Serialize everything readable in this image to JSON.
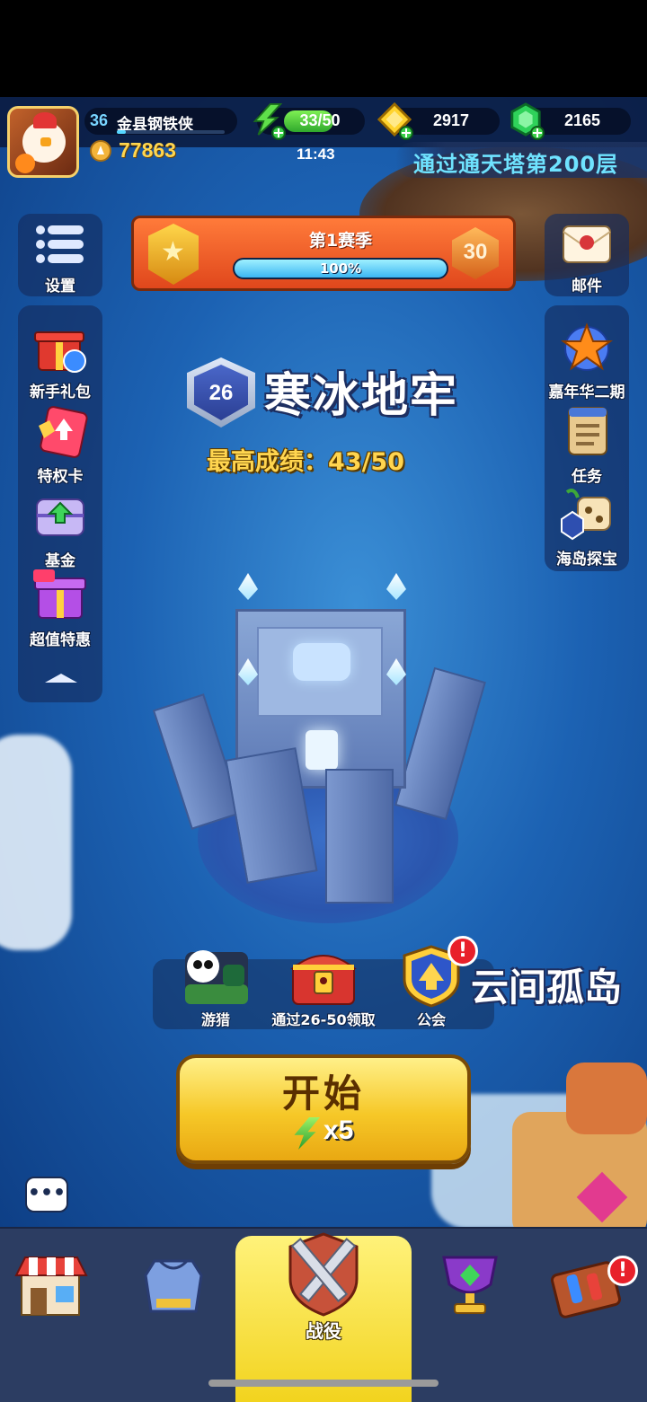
{
  "player": {
    "level": "36",
    "name": "金县钢铁侠",
    "xp_fraction": 0.08,
    "trophies": "77863"
  },
  "resources": {
    "energy": "33/50",
    "energy_fraction": 0.66,
    "gold": "2917",
    "gems": "2165",
    "energy_timer": "11:43"
  },
  "quest_banner": "通过通天塔第200层",
  "left_menu": {
    "settings": "设置",
    "items": [
      "新手礼包",
      "特权卡",
      "基金",
      "超值特惠"
    ]
  },
  "right_menu": {
    "mail": "邮件",
    "items": [
      "嘉年华二期",
      "任务",
      "海岛探宝"
    ]
  },
  "season": {
    "title": "第1赛季",
    "progress": "100%",
    "progress_fraction": 1.0,
    "level": "30"
  },
  "stage": {
    "number": "26",
    "name": "寒冰地牢",
    "best_score": "最高成绩：43/50"
  },
  "quick_actions": {
    "hunt": "游猎",
    "chest": "通过26-50领取",
    "guild": "公会",
    "guild_alert": "!"
  },
  "next_island": "云间孤岛",
  "start_button": {
    "label": "开始",
    "cost": "x5"
  },
  "chat": "•••",
  "bottom_nav": {
    "active_label": "战役",
    "alert": "!"
  },
  "colors": {
    "accent_yellow": "#f6c828",
    "nav_bg": "#2c3d62",
    "season_orange": "#e0471c",
    "alert_red": "#e8202a"
  },
  "icons": [
    "avatar-rooster",
    "lightning-energy-icon",
    "gold-coin-icon",
    "green-gem-icon",
    "settings-menu-icon",
    "mail-icon",
    "gift-icon",
    "privilege-card-icon",
    "fund-chest-icon",
    "super-deal-icon",
    "carnival-star-icon",
    "task-scroll-icon",
    "island-treasure-icon",
    "hunt-panda-icon",
    "treasure-chest-icon",
    "guild-shield-icon",
    "shop-icon",
    "armor-icon",
    "battle-swords-icon",
    "trophy-cup-icon",
    "map-board-icon"
  ]
}
